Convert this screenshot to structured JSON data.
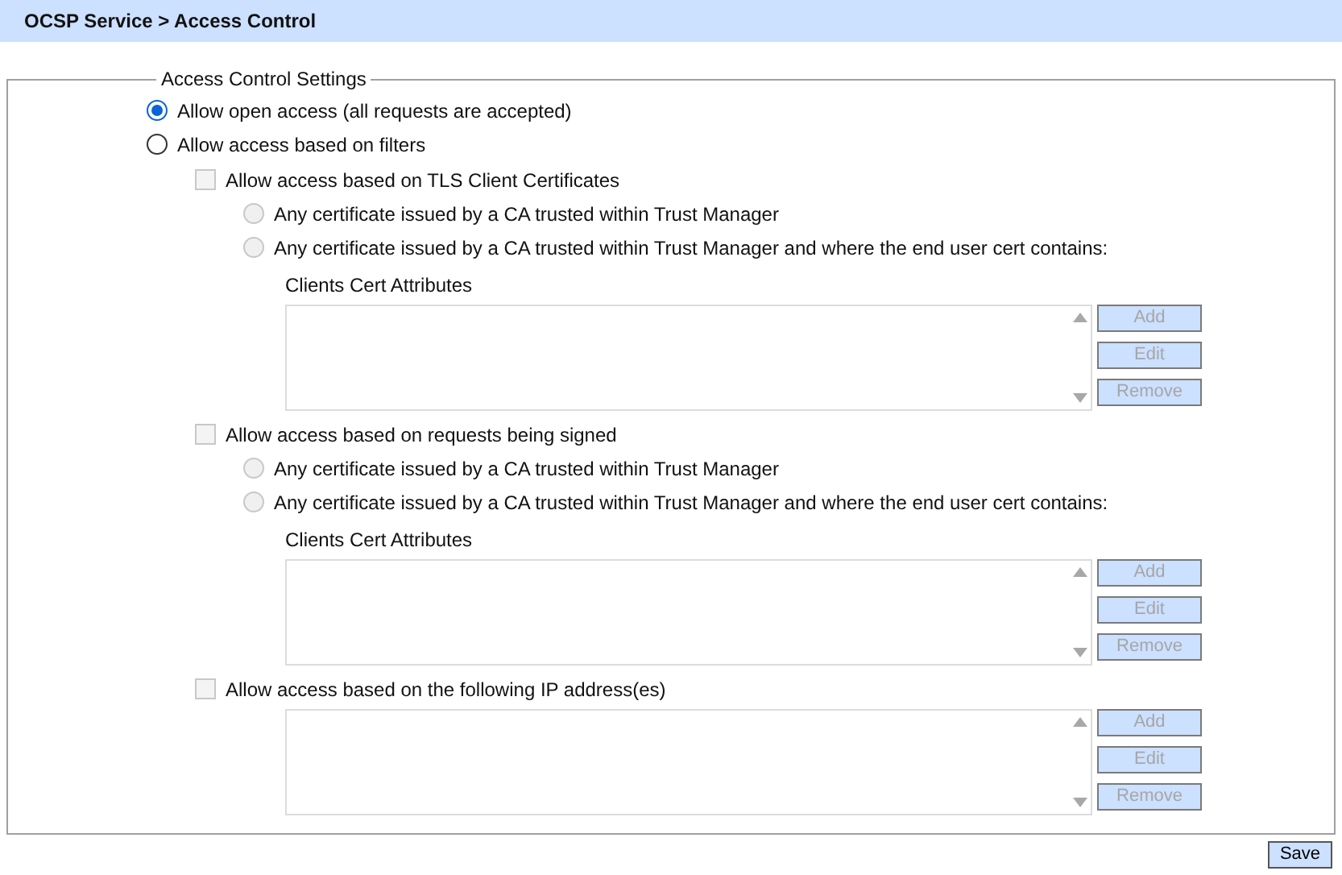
{
  "header": {
    "title": "OCSP Service > Access Control"
  },
  "settings": {
    "legend": "Access Control Settings",
    "access_modes": [
      {
        "label": "Allow open access (all requests are accepted)",
        "selected": true
      },
      {
        "label": "Allow access based on filters",
        "selected": false
      }
    ],
    "filters": [
      {
        "kind": "certificate",
        "label": "Allow access based on TLS Client Certificates",
        "checked": false,
        "disabled": true,
        "options": [
          {
            "label": "Any certificate issued by a CA trusted within Trust Manager",
            "selected": false,
            "disabled": true
          },
          {
            "label": "Any certificate issued by a CA trusted within Trust Manager and where the end user cert contains:",
            "selected": false,
            "disabled": true
          }
        ],
        "list_label": "Clients Cert Attributes",
        "buttons": [
          {
            "label": "Add",
            "disabled": true
          },
          {
            "label": "Edit",
            "disabled": true
          },
          {
            "label": "Remove",
            "disabled": true
          }
        ]
      },
      {
        "kind": "certificate",
        "label": "Allow access based on requests being signed",
        "checked": false,
        "disabled": true,
        "options": [
          {
            "label": "Any certificate issued by a CA trusted within Trust Manager",
            "selected": false,
            "disabled": true
          },
          {
            "label": "Any certificate issued by a CA trusted within Trust Manager and where the end user cert contains:",
            "selected": false,
            "disabled": true
          }
        ],
        "list_label": "Clients Cert Attributes",
        "buttons": [
          {
            "label": "Add",
            "disabled": true
          },
          {
            "label": "Edit",
            "disabled": true
          },
          {
            "label": "Remove",
            "disabled": true
          }
        ]
      },
      {
        "kind": "ip",
        "label": "Allow access based on the following IP address(es)",
        "checked": false,
        "disabled": true,
        "buttons": [
          {
            "label": "Add",
            "disabled": true
          },
          {
            "label": "Edit",
            "disabled": true
          },
          {
            "label": "Remove",
            "disabled": true
          }
        ]
      }
    ]
  },
  "footer": {
    "save_label": "Save"
  }
}
